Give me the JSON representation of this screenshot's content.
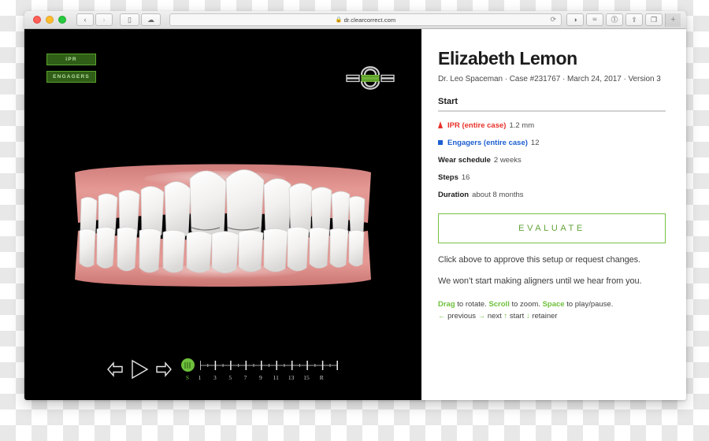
{
  "browser": {
    "url": "dr.clearcorrect.com",
    "lock_icon": "lock-icon",
    "back_label": "‹",
    "forward_label": "›",
    "sidebar_label": "▯",
    "cloud_label": "☁",
    "reload_label": "⟳",
    "tools": [
      {
        "name": "adblock-icon",
        "glyph": "◑"
      },
      {
        "name": "pocket-icon",
        "glyph": "ᵚ"
      },
      {
        "name": "info-icon",
        "glyph": "⓵"
      },
      {
        "name": "share-icon",
        "glyph": "⇪"
      },
      {
        "name": "tabs-icon",
        "glyph": "❐"
      }
    ],
    "new_tab_label": "+"
  },
  "viewer": {
    "overlay_buttons": [
      {
        "name": "ipr-toggle",
        "label": "IPR"
      },
      {
        "name": "engagers-toggle",
        "label": "ENGAGERS"
      }
    ],
    "arch_selector_name": "arch-view-selector",
    "playback": [
      {
        "name": "previous-step-button",
        "glyph": "previous"
      },
      {
        "name": "play-pause-button",
        "glyph": "play"
      },
      {
        "name": "next-step-button",
        "glyph": "next"
      }
    ],
    "timeline": {
      "handle_position_label": "S",
      "labels": [
        "S",
        "1",
        "3",
        "5",
        "7",
        "9",
        "11",
        "13",
        "15",
        "R"
      ],
      "major_ticks": 10,
      "minor_ticks": 9
    }
  },
  "detail": {
    "patient_name": "Elizabeth Lemon",
    "case_meta": "Dr. Leo Spaceman · Case #231767 · March 24, 2017 · Version 3",
    "stage_heading": "Start",
    "stats": [
      {
        "name": "ipr-stat",
        "marker": "triangle",
        "key": "IPR (entire case)",
        "value": "1.2 mm"
      },
      {
        "name": "engagers-stat",
        "marker": "square",
        "key": "Engagers (entire case)",
        "value": "12"
      },
      {
        "name": "wear-schedule-stat",
        "marker": "none",
        "key": "Wear schedule",
        "value": "2 weeks"
      },
      {
        "name": "steps-stat",
        "marker": "none",
        "key": "Steps",
        "value": "16"
      },
      {
        "name": "duration-stat",
        "marker": "none",
        "key": "Duration",
        "value": "about 8 months"
      }
    ],
    "evaluate_label": "EVALUATE",
    "note_1": "Click above to approve this setup or request changes.",
    "note_2": "We won’t start making aligners until we hear from you.",
    "hints": {
      "drag_key": "Drag",
      "drag_text": " to rotate. ",
      "scroll_key": "Scroll",
      "scroll_text": " to zoom. ",
      "space_key": "Space",
      "space_text": " to play/pause.",
      "left_arrow": "←",
      "previous_text": " previous ",
      "right_arrow": "→",
      "next_text": " next ",
      "up_arrow": "↑",
      "start_text": " start ",
      "down_arrow": "↓",
      "retainer_text": " retainer"
    }
  },
  "colors": {
    "accent_green": "#76c043",
    "ipr_red": "#e8312a",
    "engager_blue": "#1c5fd0",
    "gum_pink": "#e08b87",
    "tooth_white": "#f4f3f1"
  }
}
